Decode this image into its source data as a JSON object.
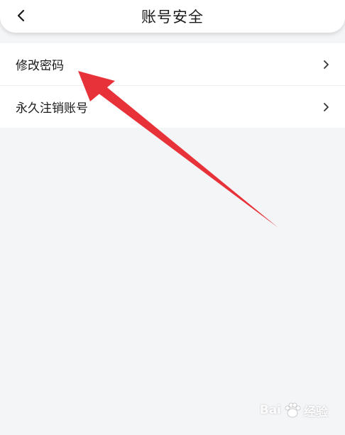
{
  "header": {
    "title": "账号安全",
    "back_icon": "chevron-left-icon"
  },
  "menu": {
    "items": [
      {
        "label": "修改密码",
        "icon": "chevron-right-icon"
      },
      {
        "label": "永久注销账号",
        "icon": "chevron-right-icon"
      }
    ]
  },
  "annotation": {
    "arrow_color": "#e8323a",
    "arrow_icon": "red-arrow-annotation"
  },
  "watermark": {
    "brand_left": "Bai",
    "brand_right": "经验",
    "logo_icon": "paw-logo-icon"
  },
  "colors": {
    "background": "#f4f5f7",
    "surface": "#ffffff",
    "text": "#1a1a1a"
  }
}
